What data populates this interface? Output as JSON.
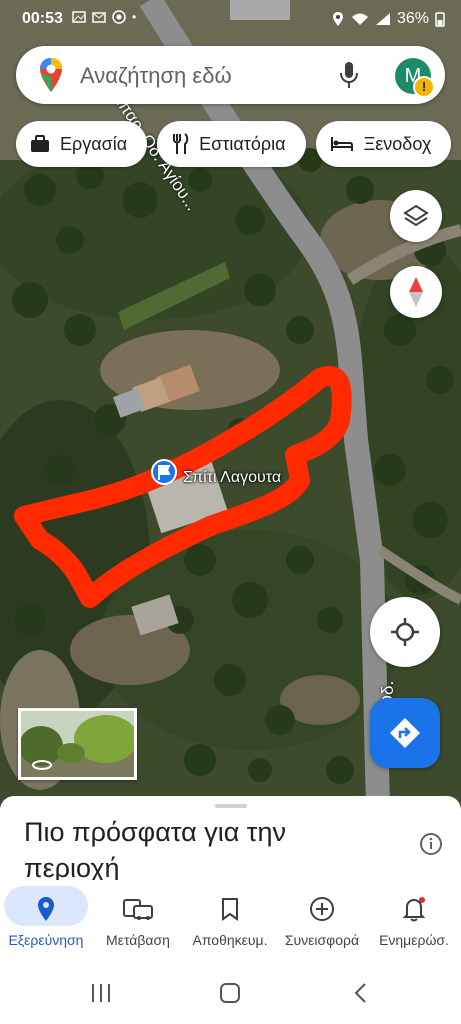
{
  "status_bar": {
    "time": "00:53",
    "battery": "36%"
  },
  "search": {
    "placeholder": "Αναζήτηση εδώ",
    "avatar_initial": "M"
  },
  "chips": [
    {
      "label": "Εργασία",
      "icon": "briefcase-icon"
    },
    {
      "label": "Εστιατόρια",
      "icon": "fork-knife-icon"
    },
    {
      "label": "Ξενοδοχ",
      "icon": "bed-icon"
    }
  ],
  "map": {
    "marker_label": "Σπίτι Λαγουτα",
    "road_label_top": "Επαρ. Οδ. Αγίου...",
    "road_label_right": "Επαρ. Οδ. Αγίου",
    "highlight_color": "#ff2a00",
    "road_color": "#8d8d8d"
  },
  "sheet": {
    "title": "Πιο πρόσφατα για την περιοχή"
  },
  "bottom_nav": [
    {
      "label": "Εξερεύνηση",
      "icon": "location-pin-icon",
      "active": true
    },
    {
      "label": "Μετάβαση",
      "icon": "commute-icon"
    },
    {
      "label": "Αποθηκευμ.",
      "icon": "bookmark-icon"
    },
    {
      "label": "Συνεισφορά",
      "icon": "add-circle-icon"
    },
    {
      "label": "Ενημερώσ.",
      "icon": "bell-icon"
    }
  ],
  "colors": {
    "accent": "#1a73e8",
    "active_pill": "#dbe8fb",
    "directions_fab": "#1a73e8"
  }
}
